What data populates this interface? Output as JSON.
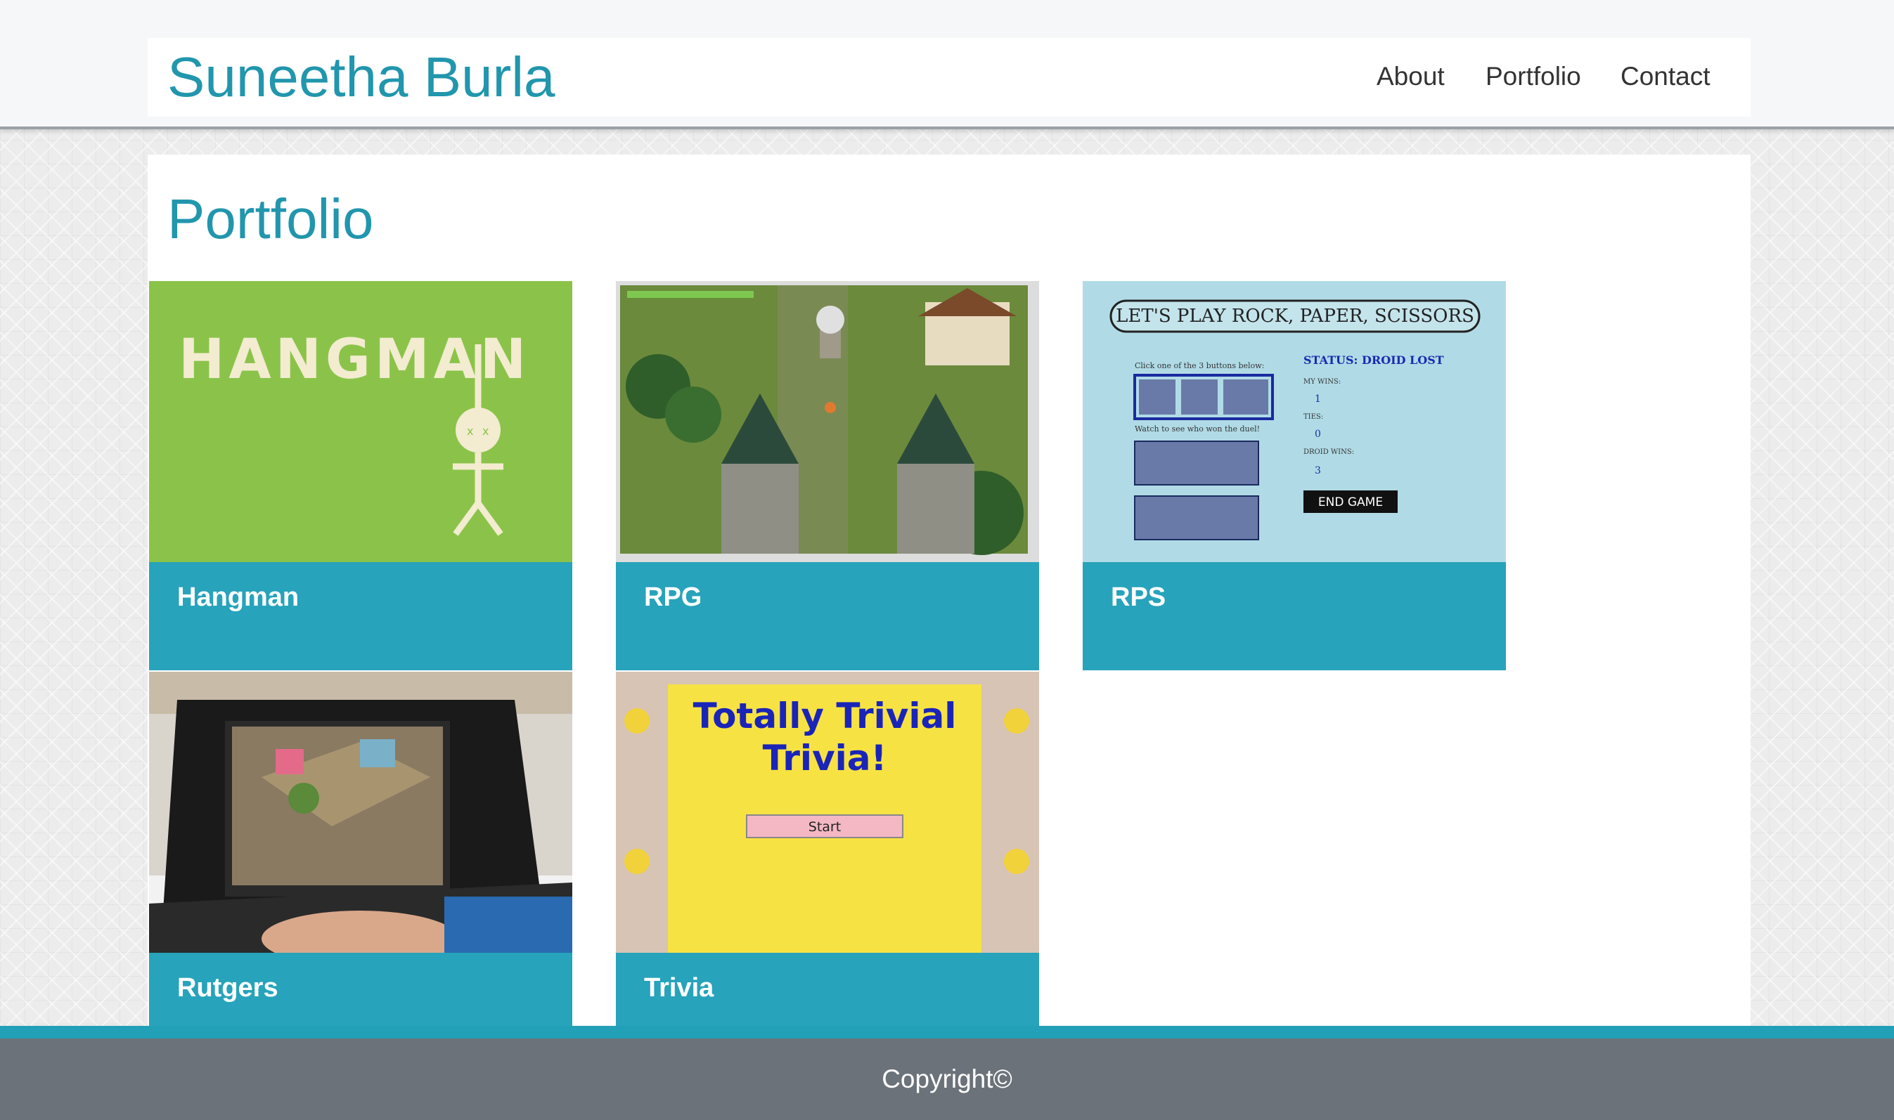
{
  "header": {
    "brand": "Suneetha Burla",
    "nav": [
      {
        "label": "About"
      },
      {
        "label": "Portfolio"
      },
      {
        "label": "Contact"
      }
    ]
  },
  "main": {
    "heading": "Portfolio",
    "cards": [
      {
        "title": "Hangman",
        "thumb": {
          "text": "HANGMAN"
        }
      },
      {
        "title": "RPG",
        "thumb": {}
      },
      {
        "title": "RPS",
        "thumb": {
          "banner": "LET'S PLAY ROCK, PAPER, SCISSORS",
          "instruction": "Click one of the 3 buttons below:",
          "watch": "Watch to see who won the duel!",
          "status": "STATUS: DROID LOST",
          "my_wins_label": "MY WINS:",
          "my_wins": "1",
          "ties_label": "TIES:",
          "ties": "0",
          "droid_wins_label": "DROID WINS:",
          "droid_wins": "3",
          "end_button": "END GAME"
        }
      },
      {
        "title": "Rutgers",
        "thumb": {}
      },
      {
        "title": "Trivia",
        "thumb": {
          "title_line1": "Totally Trivial",
          "title_line2": "Trivia!",
          "start": "Start"
        }
      }
    ]
  },
  "footer": {
    "copyright": "Copyright©"
  },
  "colors": {
    "accent": "#27a3bb",
    "brand_text": "#2196ad",
    "footer": "#6b7279"
  }
}
